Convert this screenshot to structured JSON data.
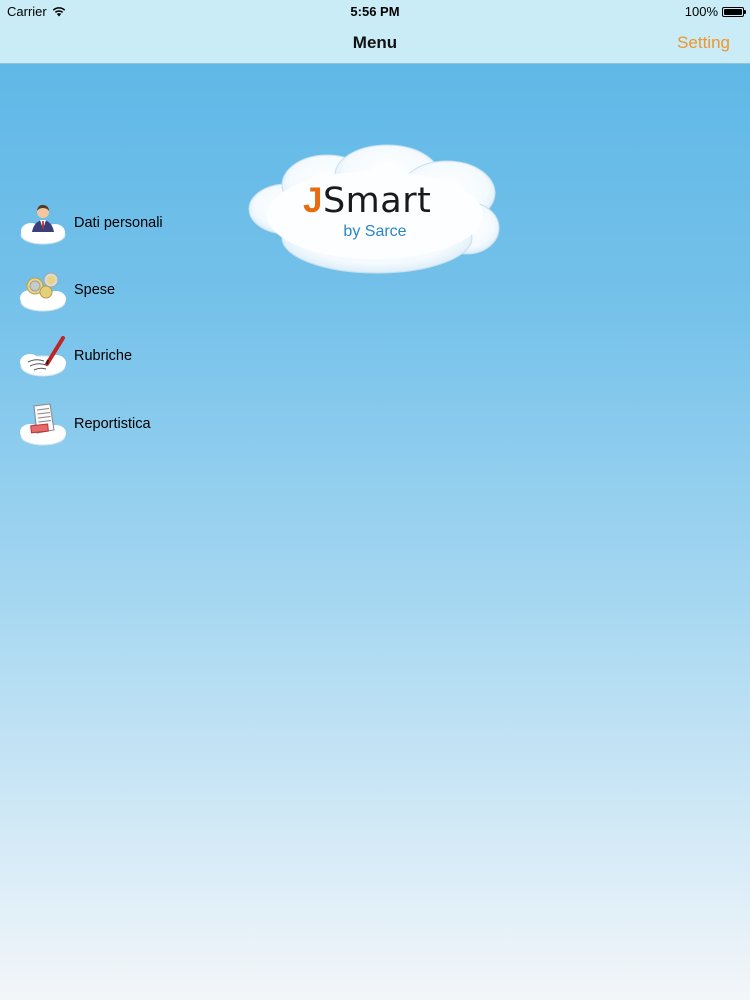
{
  "status_bar": {
    "carrier": "Carrier",
    "time": "5:56 PM",
    "battery": "100%",
    "icons": [
      "wifi-icon",
      "battery-icon"
    ]
  },
  "nav": {
    "title": "Menu",
    "setting_label": "Setting",
    "accent_color": "#f0962a"
  },
  "logo": {
    "j": "J",
    "name": "Smart",
    "subtitle": "by Sarce",
    "brand_color": "#e66c12"
  },
  "menu": {
    "items": [
      {
        "label": "Dati personali",
        "icon": "person-cloud-icon"
      },
      {
        "label": "Spese",
        "icon": "coins-cloud-icon"
      },
      {
        "label": "Rubriche",
        "icon": "pen-cloud-icon"
      },
      {
        "label": "Reportistica",
        "icon": "report-cloud-icon"
      }
    ]
  }
}
